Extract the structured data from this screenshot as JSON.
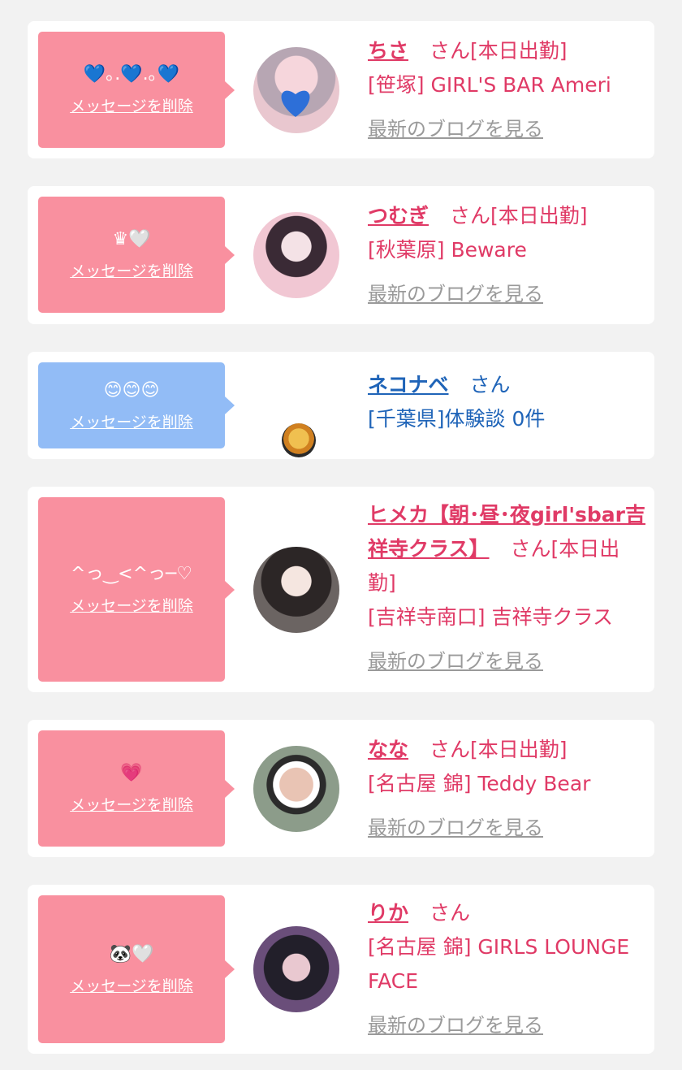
{
  "entries": [
    {
      "message": "💙｡.💙.｡💙",
      "delete_label": "メッセージを削除",
      "name": "ちさ",
      "suffix": "さん[本日出勤]",
      "shop": "[笹塚] GIRL'S BAR Ameri",
      "blog_label": "最新のブログを見る",
      "bubble_color": "#f9909f"
    },
    {
      "message": "♛🤍",
      "delete_label": "メッセージを削除",
      "name": "つむぎ",
      "suffix": "さん[本日出勤]",
      "shop": "[秋葉原] Beware",
      "blog_label": "最新のブログを見る",
      "bubble_color": "#f9909f"
    },
    {
      "message": "😊😊😊",
      "delete_label": "メッセージを削除",
      "name": "ネコナベ",
      "suffix": "さん",
      "shop": "[千葉県]体験談 0件",
      "bubble_color": "#92bcf6"
    },
    {
      "message": "^っ‿<^っ─♡",
      "delete_label": "メッセージを削除",
      "name": "ヒメカ【朝･昼･夜girl'sbar吉祥寺クラス】",
      "suffix": "さん[本日出勤]",
      "shop": "[吉祥寺南口] 吉祥寺クラス",
      "blog_label": "最新のブログを見る",
      "bubble_color": "#f9909f"
    },
    {
      "message": "💗",
      "delete_label": "メッセージを削除",
      "name": "なな",
      "suffix": "さん[本日出勤]",
      "shop": "[名古屋 錦] Teddy Bear",
      "blog_label": "最新のブログを見る",
      "bubble_color": "#f9909f"
    },
    {
      "message": "🐼🤍",
      "delete_label": "メッセージを削除",
      "name": "りか",
      "suffix": "さん",
      "shop": "[名古屋 錦] GIRLS LOUNGE FACE",
      "blog_label": "最新のブログを見る",
      "bubble_color": "#f9909f"
    }
  ]
}
